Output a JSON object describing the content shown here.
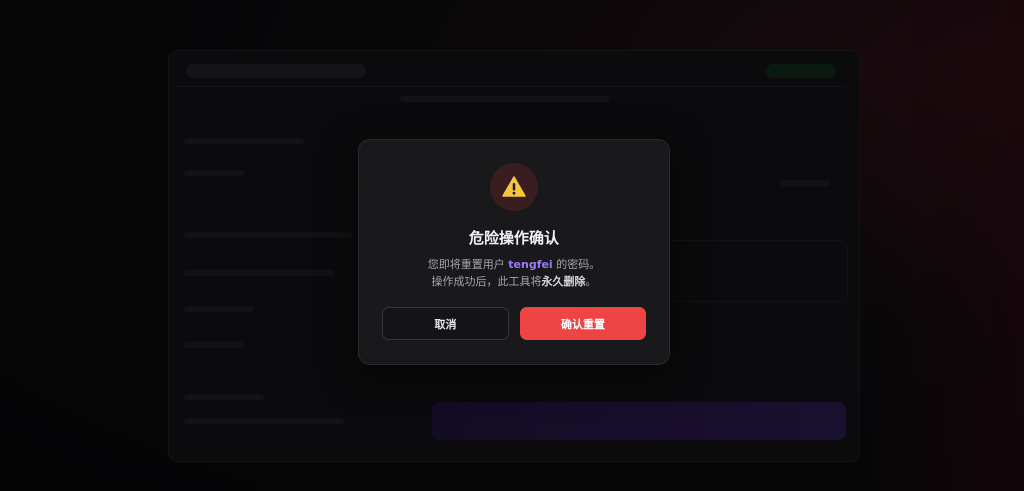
{
  "dialog": {
    "icon": "warning-icon",
    "title": "危险操作确认",
    "message_line1_prefix": "您即将重置用户",
    "username": "tengfei",
    "message_line1_suffix": "的密码。",
    "message_line2_prefix": "操作成功后，此工具将",
    "message_line2_emphasis": "永久删除",
    "message_line2_suffix": "。",
    "cancel_label": "取消",
    "confirm_label": "确认重置"
  },
  "colors": {
    "accent_danger": "#ef4444",
    "username_highlight": "#9b7bf5",
    "warning_icon": "#f5c542"
  }
}
